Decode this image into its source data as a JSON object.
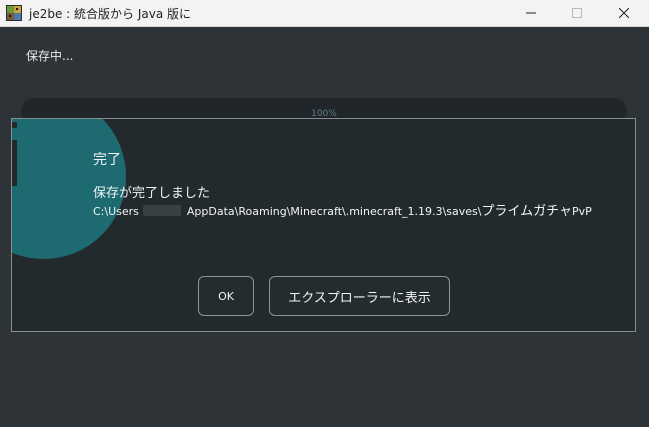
{
  "window": {
    "title": "je2be : 統合版から Java 版に",
    "icon": "je2be-app-icon",
    "controls": {
      "minimize": "minimize-icon",
      "maximize": "maximize-icon",
      "close": "close-icon"
    }
  },
  "main": {
    "status_label": "保存中...",
    "progress": {
      "value": 1.0,
      "text": "100%"
    }
  },
  "dialog": {
    "icon": "info-icon",
    "title": "完了",
    "message": "保存が完了しました",
    "path": {
      "prefix": "C:\\Users",
      "suffix": "AppData\\Roaming\\Minecraft\\.minecraft_1.19.3\\saves\\",
      "world_name": "プライムガチャ",
      "world_suffix": "PvP"
    },
    "buttons": {
      "ok": "OK",
      "explorer": "エクスプローラーに表示"
    }
  },
  "colors": {
    "background": "#2d3337",
    "accent": "#1d6b70",
    "dialog_bg": "#232a2e",
    "border": "#858d91"
  }
}
